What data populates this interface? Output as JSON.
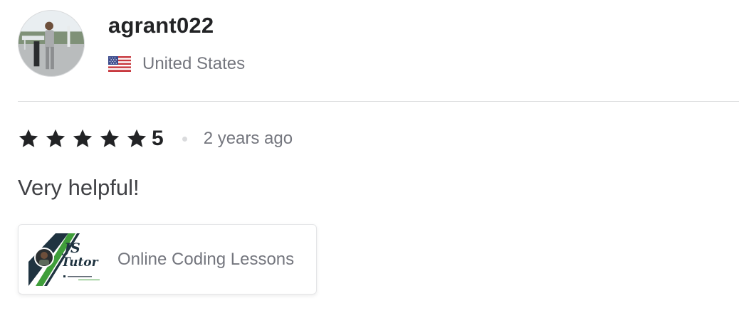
{
  "reviewer": {
    "username": "agrant022",
    "country": "United States",
    "avatar_alt": "avatar",
    "flag_icon": "us-flag-icon"
  },
  "review": {
    "rating": "5",
    "rating_stars": 5,
    "time_ago": "2 years ago",
    "text": "Very helpful!"
  },
  "gig": {
    "title": "Online Coding Lessons",
    "thumbnail_text": "JS Tutor"
  },
  "colors": {
    "text_primary": "#222325",
    "text_secondary": "#74767e",
    "divider": "#dadbdd",
    "thumb_green": "#3f9e3a",
    "thumb_dark": "#1f3340"
  }
}
